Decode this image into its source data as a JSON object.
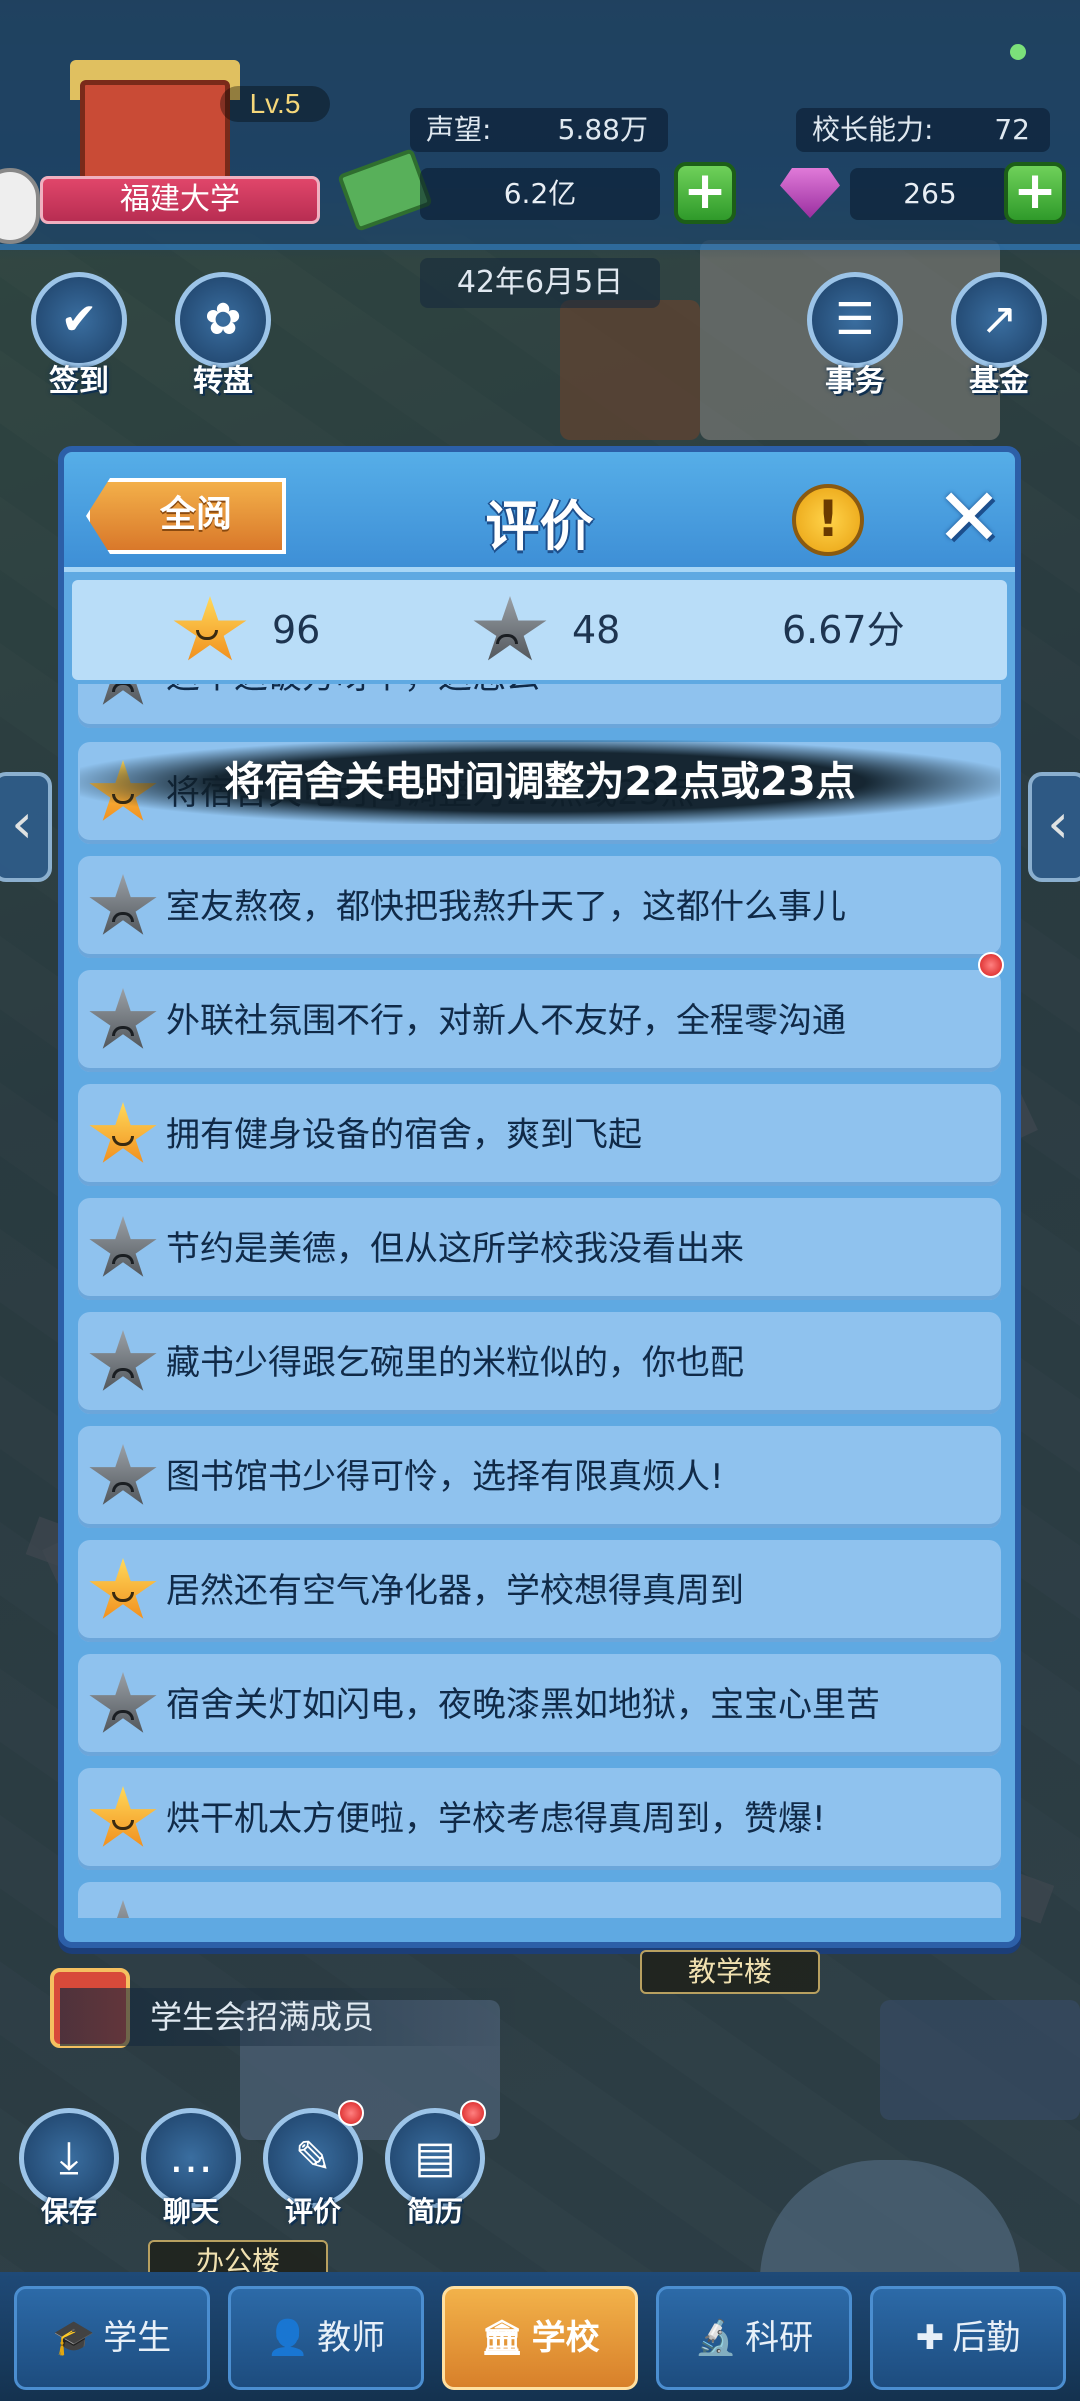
{
  "hud": {
    "level": "Lv.5",
    "school_name": "福建大学",
    "reputation_label": "声望:",
    "reputation_value": "5.88万",
    "principal_label": "校长能力:",
    "principal_value": "72",
    "money": "6.2亿",
    "gems": "265",
    "date": "42年6月5日"
  },
  "menu": {
    "checkin": "签到",
    "wheel": "转盘",
    "affairs": "事务",
    "fund": "基金"
  },
  "dialog": {
    "title": "评价",
    "read_all": "全阅",
    "info": "!",
    "close": "✕",
    "summary": {
      "good_count": "96",
      "bad_count": "48",
      "score": "6.67分"
    },
    "toast": "将宿舍关电时间调整为22点或23点",
    "reviews": [
      {
        "type": "bad",
        "text": "这个这破方呀个，这怎么"
      },
      {
        "type": "good",
        "text": "将宿舍关电时间调整为22点或23点"
      },
      {
        "type": "bad",
        "text": "室友熬夜，都快把我熬升天了，这都什么事儿"
      },
      {
        "type": "bad",
        "text": "外联社氛围不行，对新人不友好，全程零沟通"
      },
      {
        "type": "good",
        "text": "拥有健身设备的宿舍，爽到飞起"
      },
      {
        "type": "bad",
        "text": "节约是美德，但从这所学校我没看出来"
      },
      {
        "type": "bad",
        "text": "藏书少得跟乞碗里的米粒似的，你也配"
      },
      {
        "type": "bad",
        "text": "图书馆书少得可怜，选择有限真烦人!"
      },
      {
        "type": "good",
        "text": "居然还有空气净化器，学校想得真周到"
      },
      {
        "type": "bad",
        "text": "宿舍关灯如闪电，夜晚漆黑如地狱，宝宝心里苦"
      },
      {
        "type": "good",
        "text": "烘干机太方便啦，学校考虑得真周到，赞爆!"
      },
      {
        "type": "bad",
        "text": ""
      }
    ]
  },
  "bottom": {
    "notice": "学生会招满成员",
    "teaching_building": "教学楼",
    "office_building": "办公楼",
    "save": "保存",
    "chat": "聊天",
    "review": "评价",
    "resume": "简历"
  },
  "tabs": [
    {
      "label": "学生",
      "icon": "graduation-cap-icon",
      "glyph": "🎓"
    },
    {
      "label": "教师",
      "icon": "teacher-icon",
      "glyph": "👤"
    },
    {
      "label": "学校",
      "icon": "school-icon",
      "glyph": "🏛"
    },
    {
      "label": "科研",
      "icon": "microscope-icon",
      "glyph": "🔬"
    },
    {
      "label": "后勤",
      "icon": "logistics-icon",
      "glyph": "✚"
    }
  ],
  "colors": {
    "dialog_bg": "#5fa9e2",
    "row_bg": "#8fc2ee",
    "good_star": "#f7b733",
    "bad_star": "#6b7075",
    "active_tab": "#e89a38"
  }
}
